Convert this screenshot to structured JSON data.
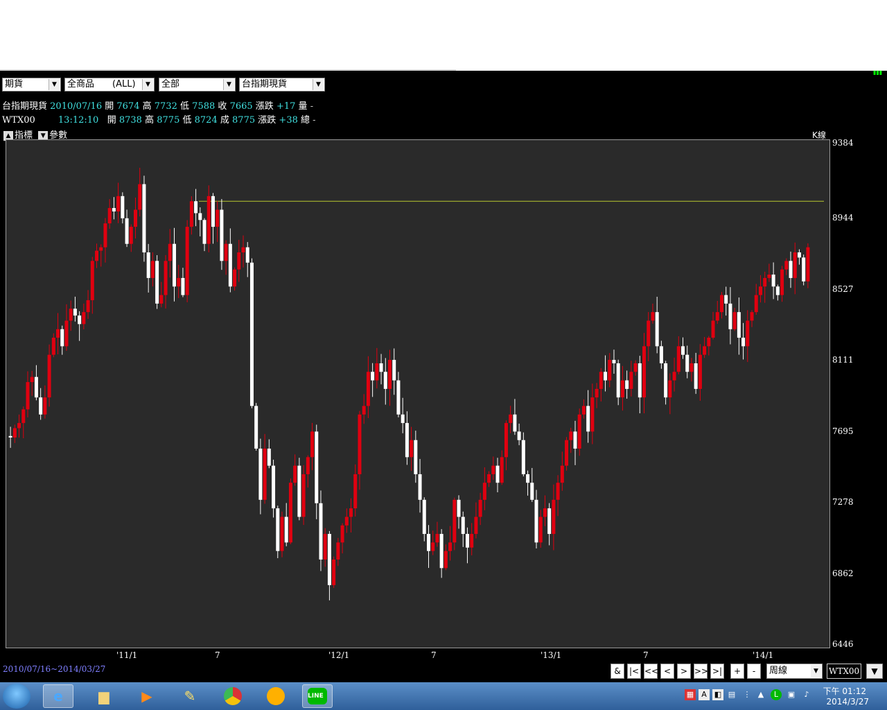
{
  "toolbar": {
    "market_select": "期貨",
    "product_select": "全商品　　(ALL)",
    "scope_select": "全部",
    "symbol_select": "台指期現貨"
  },
  "quotes": {
    "row1": {
      "name": "台指期現貨",
      "date": "2010/07/16",
      "open_label": "開",
      "open": "7674",
      "high_label": "高",
      "high": "7732",
      "low_label": "低",
      "low": "7588",
      "close_label": "收",
      "close": "7665",
      "change_label": "漲跌",
      "change": "+17",
      "vol_label": "量",
      "vol": "-"
    },
    "row2": {
      "name": "WTX00",
      "time": "13:12:10",
      "open_label": "開",
      "open": "8738",
      "high_label": "高",
      "high": "8775",
      "low_label": "低",
      "low": "8724",
      "close_label": "成",
      "close": "8775",
      "change_label": "漲跌",
      "change": "+38",
      "vol_label": "總",
      "vol": "-"
    }
  },
  "chart_tools": {
    "indicator_label": "指標",
    "params_label": "參數",
    "kline_label": "K線"
  },
  "chart_data": {
    "type": "candlestick",
    "yticks": [
      "9384",
      "8944",
      "8527",
      "8111",
      "7695",
      "7278",
      "6862",
      "6446"
    ],
    "xticks": [
      "'11/1",
      "7",
      "'12/1",
      "7",
      "'13/1",
      "7",
      "'14/1"
    ],
    "ylim": [
      6446,
      9384
    ],
    "reference_line": 9050,
    "up_color": "#e00010",
    "down_color": "#ffffff",
    "background": "#2a2a2a",
    "weekly_closes": [
      7665,
      7720,
      7750,
      7830,
      7990,
      8020,
      7900,
      7800,
      7900,
      8150,
      8250,
      8300,
      8200,
      8350,
      8420,
      8380,
      8330,
      8400,
      8470,
      8700,
      8760,
      8780,
      8920,
      9010,
      8990,
      9080,
      8950,
      8800,
      8900,
      9000,
      9150,
      8750,
      8600,
      8700,
      8450,
      8500,
      8700,
      8800,
      8550,
      8600,
      8500,
      8900,
      9050,
      8980,
      8940,
      8800,
      9080,
      8900,
      9000,
      8700,
      8800,
      8550,
      8650,
      8750,
      8780,
      8690,
      7850,
      7600,
      7300,
      7600,
      7500,
      7250,
      7000,
      7200,
      7050,
      7400,
      7500,
      7200,
      7450,
      7550,
      7700,
      7280,
      6950,
      7100,
      6800,
      6950,
      7050,
      7150,
      7200,
      7250,
      7450,
      7800,
      7850,
      8050,
      8000,
      8100,
      8050,
      7950,
      8120,
      8000,
      7800,
      7750,
      7550,
      7650,
      7450,
      7300,
      7100,
      7000,
      7050,
      7100,
      6900,
      7000,
      7050,
      7300,
      7200,
      7100,
      7020,
      7100,
      7200,
      7300,
      7400,
      7450,
      7500,
      7400,
      7550,
      7750,
      7800,
      7700,
      7650,
      7450,
      7400,
      7300,
      7050,
      7200,
      7250,
      7100,
      7300,
      7400,
      7500,
      7650,
      7700,
      7600,
      7800,
      7850,
      7700,
      7900,
      7950,
      8050,
      8000,
      8120,
      8100,
      7900,
      8000,
      7950,
      8050,
      8100,
      7900,
      8200,
      8350,
      8400,
      8200,
      8100,
      7900,
      8000,
      8050,
      8200,
      8150,
      8050,
      8100,
      7950,
      8150,
      8200,
      8250,
      8350,
      8400,
      8500,
      8450,
      8300,
      8400,
      8250,
      8200,
      8350,
      8400,
      8500,
      8550,
      8600,
      8620,
      8550,
      8500,
      8650,
      8700,
      8600,
      8750,
      8720,
      8580,
      8780
    ]
  },
  "footer": {
    "range": "2010/07/16~2014/03/27",
    "nav": [
      "&",
      "|<",
      "<<",
      "<",
      ">",
      ">>",
      ">|",
      "+",
      "-"
    ],
    "period": "周線",
    "symbol": "WTX00",
    "more": "▼"
  },
  "taskbar": {
    "apps": [
      "start-orb-icon",
      "internet-explorer-icon",
      "file-explorer-icon",
      "media-player-icon",
      "paint-tool-icon",
      "chrome-icon",
      "messenger-icon",
      "line-icon"
    ],
    "time": "下午 01:12",
    "date": "2014/3/27"
  }
}
